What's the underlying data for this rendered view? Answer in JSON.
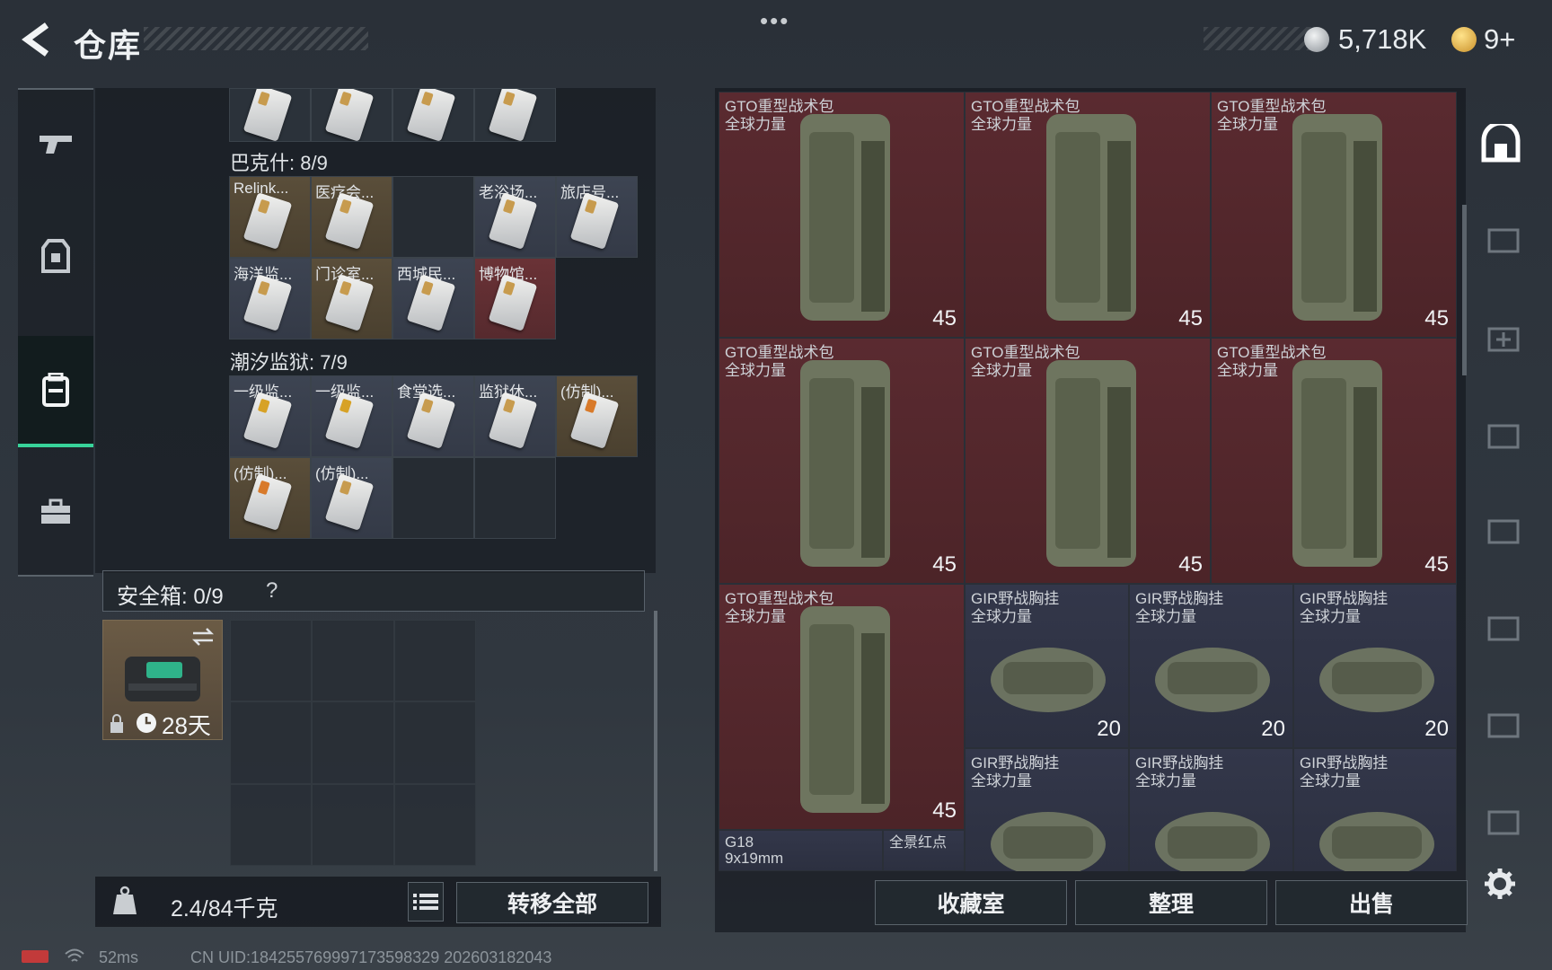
{
  "header": {
    "title": "仓库",
    "currency_amount": "5,718K",
    "premium_amount": "9+",
    "dots": "•••"
  },
  "left_nav": {
    "items": [
      "weapon-icon",
      "gear-icon",
      "backpack-icon",
      "briefcase-icon"
    ],
    "active_index": 2
  },
  "stash": {
    "top_row_count": 4,
    "sections": [
      {
        "label": "巴克什: 8/9",
        "cells": [
          {
            "label": "Relink...",
            "rarity": "y"
          },
          {
            "label": "医疗会...",
            "rarity": "y"
          },
          {
            "label": "",
            "rarity": "e"
          },
          {
            "label": "老浴场...",
            "rarity": "b"
          },
          {
            "label": "旅店号...",
            "rarity": "b"
          },
          {
            "label": "海洋监...",
            "rarity": "b"
          },
          {
            "label": "门诊室...",
            "rarity": "y"
          },
          {
            "label": "西城民...",
            "rarity": "b"
          },
          {
            "label": "博物馆...",
            "rarity": "r"
          }
        ]
      },
      {
        "label": "潮汐监狱: 7/9",
        "cells": [
          {
            "label": "一级监...",
            "rarity": "b"
          },
          {
            "label": "一级监...",
            "rarity": "b"
          },
          {
            "label": "食堂选...",
            "rarity": "b"
          },
          {
            "label": "监狱休...",
            "rarity": "b"
          },
          {
            "label": "(仿制)...",
            "rarity": "y"
          },
          {
            "label": "(仿制)...",
            "rarity": "y"
          },
          {
            "label": "(仿制)...",
            "rarity": "b"
          },
          {
            "label": "",
            "rarity": "e"
          },
          {
            "label": "",
            "rarity": "e"
          }
        ]
      }
    ]
  },
  "safe_box": {
    "label": "安全箱: 0/9",
    "help": "?",
    "duration": "28天"
  },
  "footer_left": {
    "weight": "2.4/84千克",
    "transfer_all": "转移全部"
  },
  "status_bar": {
    "ping": "52ms",
    "uid": "CN UID:1842557699971735983​29 2026031820​43"
  },
  "items": [
    {
      "name": "GTO重型战术包",
      "sub": "全球力量",
      "count": "45",
      "color": "red"
    },
    {
      "name": "GTO重型战术包",
      "sub": "全球力量",
      "count": "45",
      "color": "red"
    },
    {
      "name": "GTO重型战术包",
      "sub": "全球力量",
      "count": "45",
      "color": "red"
    },
    {
      "name": "GTO重型战术包",
      "sub": "全球力量",
      "count": "45",
      "color": "red"
    },
    {
      "name": "GTO重型战术包",
      "sub": "全球力量",
      "count": "45",
      "color": "red"
    },
    {
      "name": "GTO重型战术包",
      "sub": "全球力量",
      "count": "45",
      "color": "red"
    },
    {
      "name": "GTO重型战术包",
      "sub": "全球力量",
      "count": "45",
      "color": "red"
    },
    {
      "name": "GIR野战胸挂",
      "sub": "全球力量",
      "count": "20",
      "color": "navy"
    },
    {
      "name": "GIR野战胸挂",
      "sub": "全球力量",
      "count": "20",
      "color": "navy"
    },
    {
      "name": "GIR野战胸挂",
      "sub": "全球力量",
      "count": "20",
      "color": "navy"
    },
    {
      "name": "GIR野战胸挂",
      "sub": "全球力量",
      "count": "",
      "color": "navy"
    },
    {
      "name": "GIR野战胸挂",
      "sub": "全球力量",
      "count": "",
      "color": "navy"
    },
    {
      "name": "GIR野战胸挂",
      "sub": "全球力量",
      "count": "",
      "color": "navy"
    }
  ],
  "partial_items": {
    "gun_name": "G18",
    "gun_ammo": "9x19mm",
    "scope_name": "全景红点"
  },
  "right_buttons": {
    "collection": "收藏室",
    "organize": "整理",
    "sell": "出售"
  },
  "colors": {
    "accent": "#38d39a",
    "rare_red": "#5a2a30",
    "rare_navy": "#33374a",
    "rare_gold": "#5a4e3a"
  }
}
